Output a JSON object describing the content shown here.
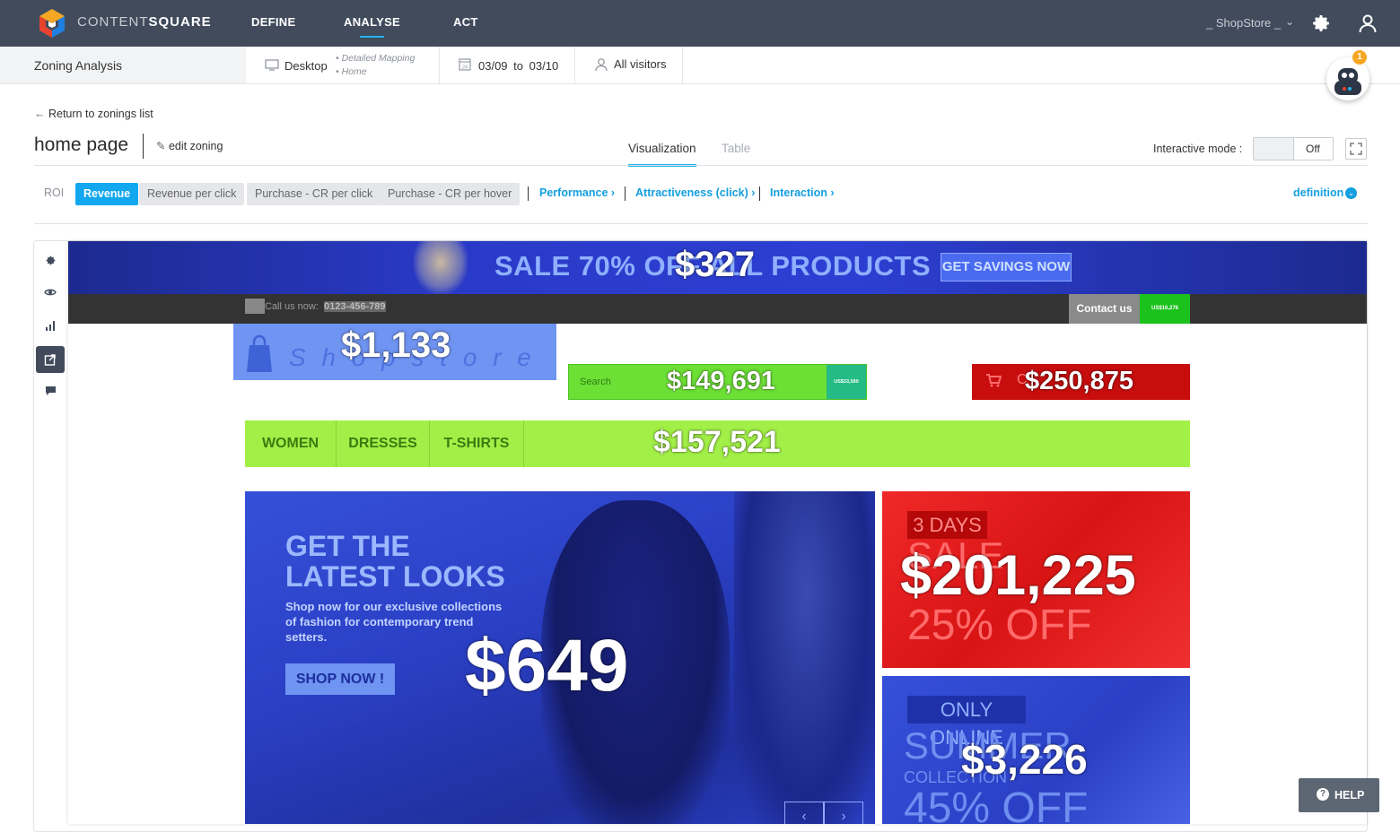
{
  "app": {
    "brand_light": "CONTENT",
    "brand_bold": "SQUARE",
    "nav": [
      "DEFINE",
      "ANALYSE",
      "ACT"
    ],
    "active_nav": "ANALYSE",
    "account": "_ ShopStore _"
  },
  "subbar": {
    "title": "Zoning Analysis",
    "device": "Desktop",
    "mapping_crumb_1": "• Detailed Mapping",
    "mapping_crumb_2": "• Home",
    "date_from": "03/09",
    "date_sep": "to",
    "date_to": "03/10",
    "calendar_day": "24",
    "segment": "All visitors",
    "notification_count": "1"
  },
  "header": {
    "return_label": "Return to zonings list",
    "page_title": "home page",
    "edit_label": "edit zoning",
    "tabs": [
      "Visualization",
      "Table"
    ],
    "interactive_label": "Interactive mode :",
    "toggle_label": "Off"
  },
  "metrics": {
    "roi_label": "ROI",
    "pills": [
      "Revenue",
      "Revenue per click",
      "Purchase - CR per click",
      "Purchase - CR per hover"
    ],
    "links": [
      "Performance ›",
      "Attractiveness (click) ›",
      "Interaction ›"
    ],
    "definition_label": "definition"
  },
  "site": {
    "banner_text": "SALE 70% OFF ALL PRODUCTS",
    "banner_cta": "GET SAVINGS NOW",
    "call_label": "Call us now:",
    "call_number": "0123-456-789",
    "contact_label": "Contact us",
    "signin_small": "US$16,276",
    "logo_text": "S h o p s t o r e",
    "search_placeholder": "Search",
    "search_btn_small": "US$33,590",
    "cart_partial": "C",
    "menu": [
      "WOMEN",
      "DRESSES",
      "T-SHIRTS"
    ],
    "hero_title_1": "GET THE",
    "hero_title_2": "LATEST LOOKS",
    "hero_sub_1": "Shop now for our exclusive collections",
    "hero_sub_2": "of fashion for contemporary trend",
    "hero_sub_3": "setters.",
    "hero_cta": "SHOP NOW !",
    "promo1_tag": "3 DAYS",
    "promo1_line1": "SALE",
    "promo1_line2": "25% OFF",
    "promo2_tag": "ONLY ONLINE",
    "promo2_line1": "SUMMER",
    "promo2_line2": "COLLECTION",
    "promo2_line3": "45% OFF"
  },
  "zones": {
    "banner": "$327",
    "logo": "$1,133",
    "search": "$149,691",
    "cart": "$250,875",
    "menu": "$157,521",
    "hero": "$649",
    "promo1": "$201,225",
    "promo2": "$3,226"
  },
  "help_label": "HELP",
  "colors": {
    "topnav": "#414b5c",
    "accent": "#12a7ee",
    "zone_blue": "#2c3fd0",
    "zone_green": "#8cf03a",
    "zone_red": "#e01818"
  }
}
